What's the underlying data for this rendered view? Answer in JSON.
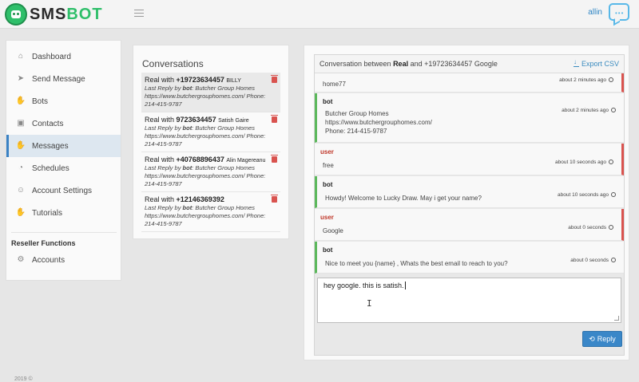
{
  "header": {
    "logo_sms": "SMS",
    "logo_bot": "BOT",
    "user_name": "allin"
  },
  "sidebar": {
    "items": [
      {
        "label": "Dashboard",
        "icon": "home-icon"
      },
      {
        "label": "Send Message",
        "icon": "paper-plane-icon"
      },
      {
        "label": "Bots",
        "icon": "hand-icon"
      },
      {
        "label": "Contacts",
        "icon": "briefcase-icon"
      },
      {
        "label": "Messages",
        "icon": "hand-icon"
      },
      {
        "label": "Schedules",
        "icon": "dashboard-icon"
      },
      {
        "label": "Account Settings",
        "icon": "user-icon"
      },
      {
        "label": "Tutorials",
        "icon": "hand-icon"
      }
    ],
    "active_index": 4,
    "reseller_heading": "Reseller Functions",
    "accounts_label": "Accounts"
  },
  "conversations": {
    "title": "Conversations",
    "items": [
      {
        "prefix": "Real with ",
        "number": "+19723634457",
        "name": "BILLY",
        "last_reply_label": "Last Reply by ",
        "last_reply_by": "bot",
        "last_reply_text": ": Butcher Group Homes https://www.butchergrouphomes.com/ Phone: 214-415-9787"
      },
      {
        "prefix": "Real with ",
        "number": "9723634457",
        "name": "Satish Gaire",
        "last_reply_label": "Last Reply by ",
        "last_reply_by": "bot",
        "last_reply_text": ": Butcher Group Homes https://www.butchergrouphomes.com/ Phone: 214-415-9787"
      },
      {
        "prefix": "Real with ",
        "number": "+40768896437",
        "name": "Alin Magereanu",
        "last_reply_label": "Last Reply by ",
        "last_reply_by": "bot",
        "last_reply_text": ": Butcher Group Homes https://www.butchergrouphomes.com/ Phone: 214-415-9787"
      },
      {
        "prefix": "Real with ",
        "number": "+12146369392",
        "name": "",
        "last_reply_label": "Last Reply by ",
        "last_reply_by": "bot",
        "last_reply_text": ": Butcher Group Homes https://www.butchergrouphomes.com/ Phone: 214-415-9787"
      }
    ]
  },
  "chat": {
    "title_prefix": "Conversation between ",
    "title_bold": "Real",
    "title_suffix": " and +19723634457 Google",
    "export_label": "Export CSV",
    "messages": [
      {
        "type": "user",
        "sender": "",
        "text": "home77",
        "time": "about 2 minutes ago"
      },
      {
        "type": "bot",
        "sender": "bot",
        "lines": [
          "Butcher Group Homes",
          "https://www.butchergrouphomes.com/",
          "Phone: 214-415-9787"
        ],
        "time": "about 2 minutes ago"
      },
      {
        "type": "user",
        "sender": "user",
        "text": "free",
        "time": "about 10 seconds ago"
      },
      {
        "type": "bot",
        "sender": "bot",
        "text": "Howdy! Welcome to Lucky Draw. May i get your name?",
        "time": "about 10 seconds ago"
      },
      {
        "type": "user",
        "sender": "user",
        "text": "Google",
        "time": "about 0 seconds"
      },
      {
        "type": "bot",
        "sender": "bot",
        "text": "Nice to meet you {name} , Whats the best email to reach to you?",
        "time": "about 0 seconds"
      }
    ],
    "reply_value": "hey google.  this is satish.",
    "reply_button": "Reply"
  },
  "footer": {
    "text": "2019 ©"
  }
}
